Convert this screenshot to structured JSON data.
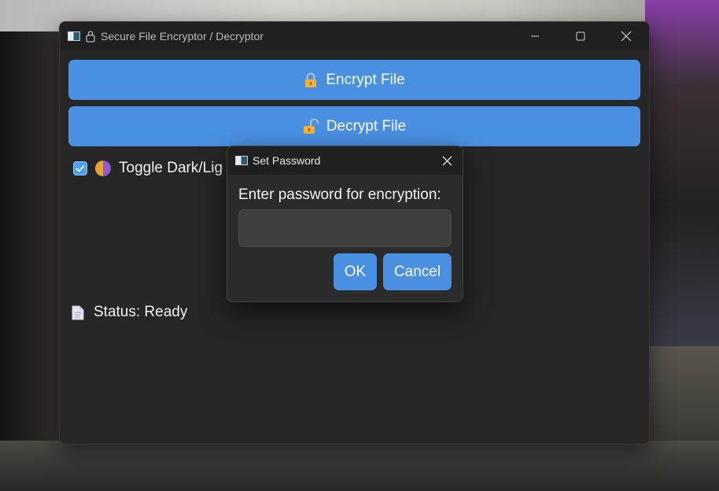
{
  "window": {
    "title": "Secure File Encryptor / Decryptor",
    "icons": [
      "app-icon",
      "lock-icon"
    ],
    "controls": [
      "minimize-icon",
      "maximize-icon",
      "close-icon"
    ]
  },
  "main": {
    "encrypt_label": "Encrypt File",
    "decrypt_label": "Decrypt File",
    "encrypt_icon": "lock-closed-icon",
    "decrypt_icon": "lock-open-icon",
    "theme_toggle": {
      "label": "Toggle Dark/Lig",
      "checked": true,
      "icon": "half-moon-icon"
    },
    "status": "Status: Ready",
    "status_icon": "document-icon"
  },
  "dialog": {
    "title": "Set Password",
    "prompt": "Enter password for encryption:",
    "password_value": "",
    "ok_label": "OK",
    "cancel_label": "Cancel"
  },
  "colors": {
    "accent": "#4a90e2",
    "window_bg": "#262626",
    "titlebar_bg": "#202020",
    "dialog_bg": "#2b2b2b",
    "input_bg": "#3e3e3e"
  }
}
